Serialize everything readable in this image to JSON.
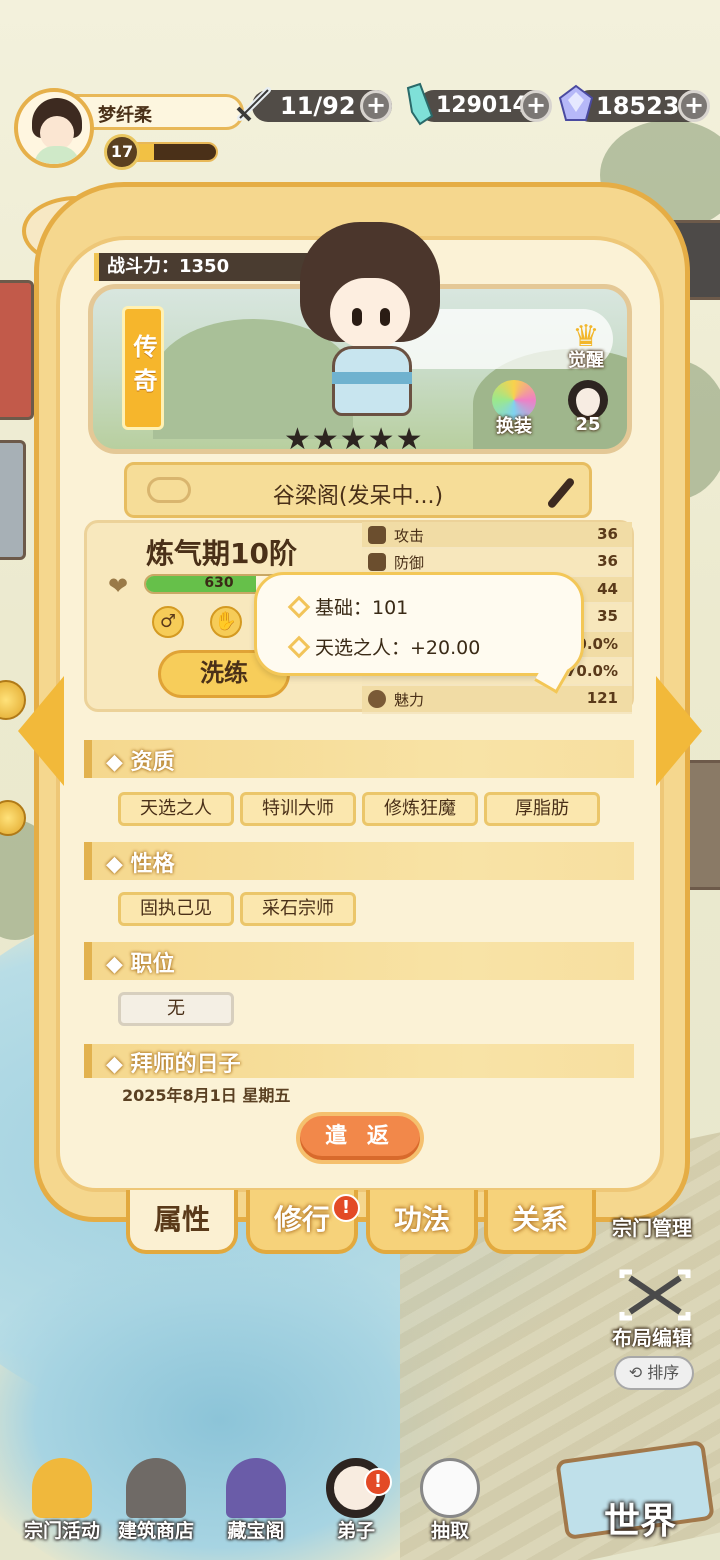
{
  "player": {
    "name": "梦纤柔",
    "level": "17",
    "level_progress": 0.4
  },
  "resources": {
    "stamina": {
      "icon": "sword-icon",
      "value": "11/92"
    },
    "jade": {
      "icon": "jade-crystal-icon",
      "value": "129014"
    },
    "gem": {
      "icon": "diamond-gem-icon",
      "value": "18523"
    }
  },
  "disciple": {
    "power_label": "战斗力：1350",
    "rarity": "传奇",
    "stars": "★★★★★",
    "awaken_label": "觉醒",
    "swap_label": "换装",
    "pet_count": "25",
    "sect_status": "谷梁阁(发呆中...)",
    "realm": "炼气期10阶",
    "hp": "630",
    "hp_progress": 0.75,
    "train_label": "洗练",
    "attributes": [
      {
        "name": "攻击",
        "value": "36",
        "icon": "fist-icon"
      },
      {
        "name": "防御",
        "value": "36",
        "icon": "shield-icon"
      },
      {
        "name": "",
        "value": "44",
        "icon": ""
      },
      {
        "name": "",
        "value": "35",
        "icon": ""
      },
      {
        "name": "",
        "value": "0.0%",
        "icon": ""
      },
      {
        "name": "",
        "value": "170.0%",
        "icon": ""
      },
      {
        "name": "魅力",
        "value": "121",
        "icon": "heart-icon"
      }
    ],
    "tooltip": {
      "base": "基础：101",
      "bonus": "天选之人：+20.00"
    }
  },
  "sections": {
    "aptitude": {
      "title": "◆ 资质",
      "tags": [
        "天选之人",
        "特训大师",
        "修炼狂魔",
        "厚脂肪"
      ]
    },
    "personality": {
      "title": "◆ 性格",
      "tags": [
        "固执己见",
        "采石宗师"
      ]
    },
    "position": {
      "title": "◆ 职位",
      "tags": [
        "无"
      ]
    },
    "apprentice": {
      "title": "◆ 拜师的日子",
      "date": "2025年8月1日 星期五"
    }
  },
  "send_label": "遣 返",
  "tabs": [
    "属性",
    "修行",
    "功法",
    "关系"
  ],
  "tab_badge": "!",
  "side": {
    "sect_manage": "宗门管理",
    "layout_edit": "布局编辑",
    "sort": "排序",
    "world": "世界"
  },
  "nav": [
    "宗门活动",
    "建筑商店",
    "藏宝阁",
    "弟子",
    "抽取"
  ],
  "nav_badge": "!",
  "colors": {
    "accent": "#e5ad45",
    "panel": "#fbf2d6",
    "send_button": "#f2884a",
    "hp": "#66c04a",
    "badge": "#e34a26"
  }
}
